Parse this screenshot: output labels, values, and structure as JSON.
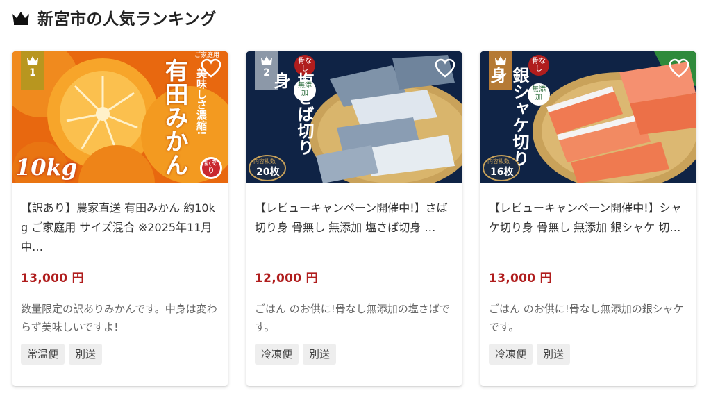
{
  "header": {
    "title": "新宮市の人気ランキング",
    "icon": "crown-icon"
  },
  "colors": {
    "price": "#b01d1d",
    "rank_gold": "#b8961f",
    "rank_silver": "#8c98a8",
    "rank_bronze": "#b57a35",
    "tag_bg": "#eeeeee"
  },
  "products": [
    {
      "rank": "1",
      "image_text": {
        "main": "有田みかん",
        "weight": "10kg",
        "side": "美味しさ濃縮!",
        "corner": "ご家庭用",
        "stamp": "訳あり"
      },
      "name": "【訳あり】農家直送 有田みかん 約10kg ご家庭用 サイズ混合 ※2025年11月中…",
      "price": "13,000 円",
      "description": "数量限定の訳ありみかんです。中身は変わらず美味しいですよ!",
      "tags": [
        "常温便",
        "別送"
      ]
    },
    {
      "rank": "2",
      "image_text": {
        "main": "塩さば切り身",
        "badge1": "骨なし",
        "badge2": "無添加",
        "count_label": "内容枚数",
        "count": "20枚"
      },
      "name": "【レビューキャンペーン開催中!】さば切り身 骨無し 無添加 塩さば切身 …",
      "price": "12,000 円",
      "description": "ごはん のお供に!骨なし無添加の塩さばです。",
      "tags": [
        "冷凍便",
        "別送"
      ]
    },
    {
      "rank": "3",
      "image_text": {
        "main": "銀シャケ切り身",
        "badge1": "骨なし",
        "badge2": "無添加",
        "count_label": "内容枚数",
        "count": "16枚"
      },
      "name": "【レビューキャンペーン開催中!】シャケ切り身 骨無し 無添加 銀シャケ 切…",
      "price": "13,000 円",
      "description": "ごはん のお供に!骨なし無添加の銀シャケです。",
      "tags": [
        "冷凍便",
        "別送"
      ]
    }
  ]
}
